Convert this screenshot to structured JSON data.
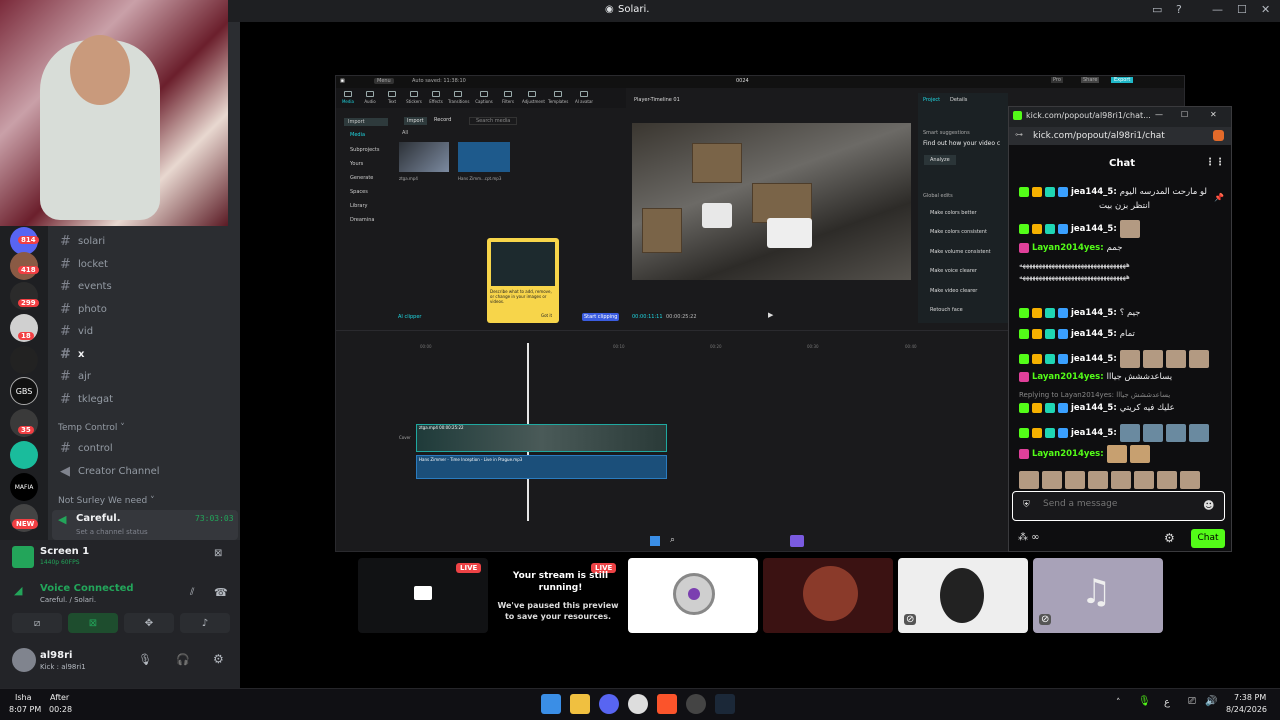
{
  "window": {
    "title": "Solari."
  },
  "servers": {
    "badges": [
      "814",
      "418",
      "299",
      "18",
      "35"
    ],
    "labels": [
      "GBS",
      "MAFIA"
    ],
    "new_badge": "NEW"
  },
  "channels": {
    "text_channels": [
      "solari",
      "locket",
      "events",
      "photo",
      "vid",
      "x",
      "ajr",
      "tklegat"
    ],
    "temp_category": "Temp Control",
    "temp_items": [
      "control",
      "Creator Channel"
    ],
    "not_surley_category": "Not Surley We need",
    "voice_channel": "Careful.",
    "voice_timer": "73:03:03",
    "channel_status_placeholder": "Set a channel status"
  },
  "screen_share": {
    "title": "Screen 1",
    "quality": "1440p 60FPS"
  },
  "voice": {
    "status": "Voice Connected",
    "location": "Careful. / Solari."
  },
  "user": {
    "name": "al98ri",
    "status": "Kick : al98ri1"
  },
  "capcut": {
    "menu_label": "Menu",
    "autosave": "Auto saved: 11:38:10",
    "window_title": "0024",
    "top_buttons": [
      "Pro",
      "Share",
      "Export"
    ],
    "tools": [
      "Media",
      "Audio",
      "Text",
      "Stickers",
      "Effects",
      "Transitions",
      "Captions",
      "Filters",
      "Adjustment",
      "Templates",
      "AI avatar"
    ],
    "sidebar": [
      "Import",
      "Media",
      "Subprojects",
      "Yours",
      "Generate",
      "Spaces",
      "Library",
      "Dreamina"
    ],
    "media_tabs": [
      "Import",
      "Record"
    ],
    "search_placeholder": "Search media",
    "all_label": "All",
    "clip_names": [
      "ztga.mp4",
      "Hans Zimm...cpt.mp3"
    ],
    "clip_duration": "00:11",
    "player_label": "Player-Timeline 01",
    "project_tabs": [
      "Project",
      "Details"
    ],
    "smart_title": "Smart suggestions",
    "smart_text": "Find out how your video c",
    "analyze_label": "Analyze",
    "global_edits": "Global edits",
    "edits": [
      "Make colors better",
      "Make colors consistent",
      "Make volume consistent",
      "Make voice clearer",
      "Make video clearer",
      "Retouch face"
    ],
    "timecode_current": "00:00:11:11",
    "timecode_total": "00:00:25:22",
    "ai_clipper": "AI clipper",
    "popup_text": "Describe what to add, remove, or change in your images or videos.",
    "popup_button": "Got it",
    "start_clipping": "Start clipping",
    "track_video_label": "ztga.mp4  00:00:25:22",
    "track_audio_label": "Hans Zimmer - Time Inception - Live in Prague.mp3",
    "cover_label": "Cover",
    "timeline_marks": [
      "00:00",
      "00:10",
      "00:20",
      "00:30",
      "00:40"
    ]
  },
  "chat": {
    "url_title": "kick.com/popout/al98ri1/chat...",
    "url": "kick.com/popout/al98ri1/chat",
    "header": "Chat",
    "messages": [
      {
        "user": "jea144_5:",
        "text": "لو مارحت المدرسه اليوم",
        "line2": "انتظر بزن بيت"
      },
      {
        "user": "jea144_5:",
        "text": ""
      },
      {
        "user": "Layan2014yes:",
        "text": "جمم"
      },
      {
        "user": "",
        "text": "هههههههههههههههههههههههههههههههههه"
      },
      {
        "user": "jea144_5:",
        "text": "جيم ؟"
      },
      {
        "user": "jea144_5:",
        "text": "تمام"
      },
      {
        "user": "jea144_5:",
        "text": ""
      },
      {
        "user": "Layan2014yes:",
        "text": "يساعدششش جيااا"
      },
      {
        "user": "jea144_5:",
        "text": "عليك فيه كريتي",
        "reply": "Replying to Layan2014yes: يساعدششش جيااا"
      },
      {
        "user": "jea144_5:",
        "text": ""
      },
      {
        "user": "Layan2014yes:",
        "text": ""
      }
    ],
    "input_placeholder": "Send a message",
    "send_label": "Chat"
  },
  "tiles": {
    "live_label": "LIVE",
    "stream_text_1": "Your stream is still running!",
    "stream_text_2": "We've paused this preview to save your resources."
  },
  "taskbar": {
    "prayer_name": "Isha",
    "prayer_time": "8:07 PM",
    "after_label": "After",
    "after_time": "00:28",
    "clock_time": "7:38 PM",
    "clock_date": "8/24/2026",
    "lang": "ع"
  },
  "colors": {
    "kick_green": "#53fc18",
    "discord_green": "#23a55a",
    "live_red": "#ed4245"
  }
}
